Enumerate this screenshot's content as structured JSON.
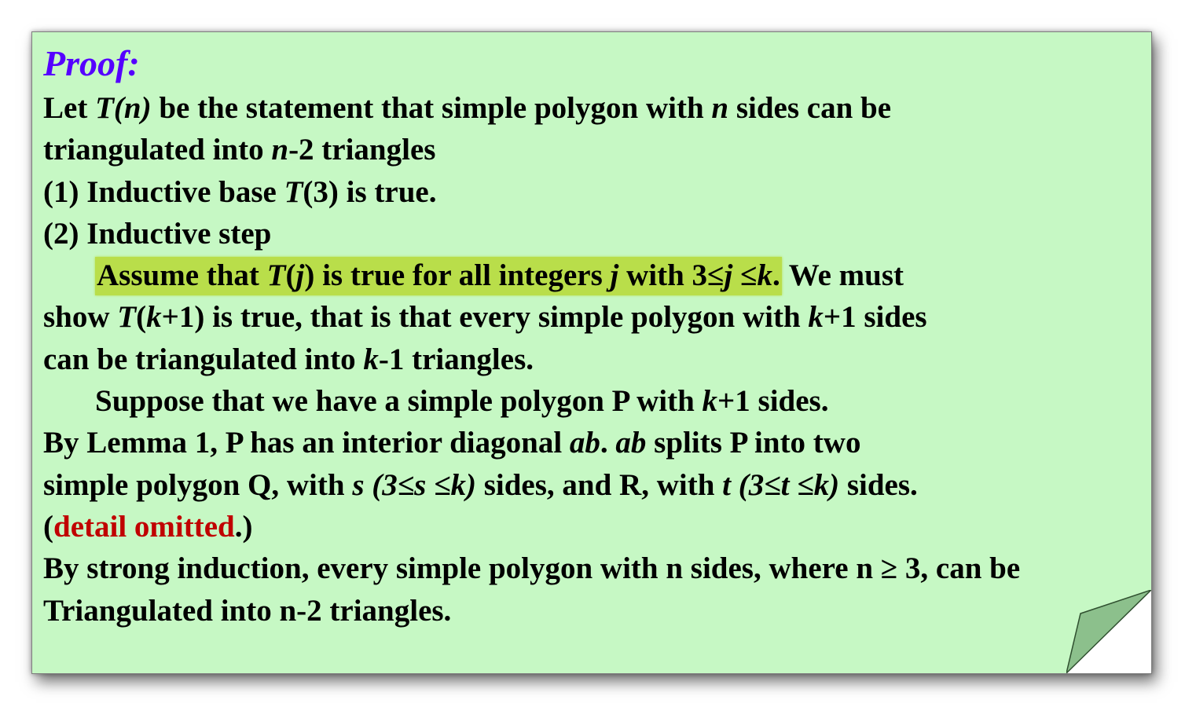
{
  "title": "Proof:",
  "lines": {
    "l1": [
      "Let ",
      "T(n)",
      " be the statement that simple polygon with ",
      "n",
      " sides can be"
    ],
    "l2": [
      "triangulated into ",
      "n",
      "-2 triangles"
    ],
    "l3": [
      "(1) Inductive base ",
      "T",
      "(3) is true."
    ],
    "l4": "(2) Inductive step",
    "l5": [
      "Assume that ",
      "T",
      "(",
      "j",
      ") is true for all integers ",
      "j",
      " with 3≤",
      "j",
      " ≤",
      "k",
      ".",
      " We must"
    ],
    "l6": [
      "show ",
      "T",
      "(",
      "k",
      "+1) is true, that is that every simple polygon with ",
      "k",
      "+1 sides"
    ],
    "l7": [
      "can be triangulated into ",
      "k",
      "-1 triangles."
    ],
    "l8": [
      "Suppose that we have a simple polygon P with ",
      "k",
      "+1 sides."
    ],
    "l9": [
      "By Lemma 1, P has an interior diagonal ",
      "ab",
      ". ",
      "ab",
      " splits P into two"
    ],
    "l10": [
      "simple  polygon Q, with ",
      "s (3≤s ≤k)",
      " sides, and R, with ",
      "t (3≤t ≤k)",
      " sides."
    ],
    "l11": [
      "(",
      "detail omitted",
      ".)"
    ],
    "l12": "By strong induction, every simple polygon with n sides, where n ≥ 3, can be",
    "l13": "Triangulated into n-2 triangles."
  },
  "colors": {
    "background": "#c6f8c4",
    "title": "#5500ff",
    "highlight": "#b9de4a",
    "emphasis": "#c00000",
    "page_curl": "#8cc08c"
  },
  "icons": {
    "corner": "page-curl-icon"
  }
}
